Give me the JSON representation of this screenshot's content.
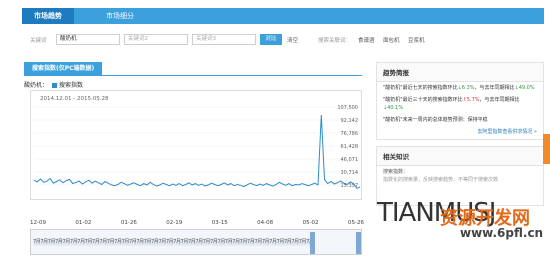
{
  "tabs": {
    "active": "市场趋势",
    "second": "市场细分"
  },
  "keywords": {
    "label": "关键词",
    "kw1_value": "酸奶机",
    "kw2_placeholder": "关键词2",
    "kw3_placeholder": "关键词3",
    "compare_label": "对比",
    "clear_label": "清空",
    "hot_label": "搜索关联词：",
    "hot": [
      "食谱酒",
      "面包机",
      "豆浆机"
    ]
  },
  "panel": {
    "title": "搜索指数(仅PC端数据)",
    "legend_prefix": "酸奶机：",
    "legend_series": "搜索指数",
    "date_range": "2014.12.01 - 2015.05.28",
    "series_color": "#2e8ccc"
  },
  "chart_data": {
    "type": "line",
    "x_tick_labels": [
      "12-09",
      "01-02",
      "01-26",
      "02-19",
      "03-15",
      "04-08",
      "05-02",
      "05-26"
    ],
    "y_tick_labels": [
      "107,500",
      "92,142",
      "76,786",
      "61,428",
      "46,071",
      "30,714",
      "15,357"
    ],
    "ylim": [
      0,
      107500
    ],
    "series": [
      {
        "name": "搜索指数",
        "values": [
          21000,
          19000,
          22500,
          18500,
          20000,
          23000,
          17500,
          19500,
          21500,
          18000,
          20500,
          22000,
          17000,
          18500,
          20000,
          16500,
          19000,
          21000,
          17500,
          20000,
          18000,
          16000,
          19500,
          17500,
          15500,
          14500,
          16000,
          18500,
          17000,
          15000,
          16500,
          18000,
          16000,
          14500,
          17000,
          15500,
          18500,
          16000,
          14000,
          15500,
          17500,
          16000,
          14500,
          16500,
          15000,
          17000,
          14500,
          16000,
          18000,
          15500,
          17000,
          15000,
          16500,
          14000,
          15500,
          17500,
          16000,
          14500,
          16000,
          18000,
          15500,
          17000,
          14500,
          16000,
          15000,
          13500,
          15500,
          17500,
          16000,
          14500,
          16500,
          15000,
          17000,
          15500,
          14000,
          16000,
          18500,
          16500,
          15000,
          17000,
          14500,
          16000,
          15500,
          17000,
          16000,
          14500,
          16000,
          17500,
          15500,
          98000,
          22000,
          17000,
          19500,
          16500,
          18000,
          20000,
          17500,
          16000,
          19000,
          17000,
          11500,
          13000
        ]
      }
    ]
  },
  "slider": {
    "ticks": "7月7月7月7月7月7月7月7月7月7月7月7月7月7月7月7月7月7月7月7月7月7月7月7月7月7月7月7月7月7月7月7月7月7月7月7月7月7月7月"
  },
  "trend": {
    "title": "趋势简报",
    "l1_a": "\"酸奶机\"最近七天的搜索指数环比",
    "l1_b": "↓6.3%",
    "l1_c": "，与去年同期相比",
    "l1_d": "↓49.0%",
    "l2_a": "\"酸奶机\"最近三十天的搜索指数环比",
    "l2_b": "↑5.7%",
    "l2_c": "，与去年同期相比",
    "l2_d": "↓40.1%",
    "l3_a": "\"酸奶机\"未来一周内的总体趋势预测：",
    "l3_b": "保持平稳",
    "link": "去阿里指数查看供求情况 »"
  },
  "related": {
    "title": "相关知识",
    "sub": "搜索指数：",
    "desc": "指数化的搜索量，反映搜索趋势，不等同于搜索次数"
  },
  "watermark": {
    "text": "TIANMUSJ",
    "cn": "资源开发网",
    "url": "www.6pfl.cn"
  }
}
